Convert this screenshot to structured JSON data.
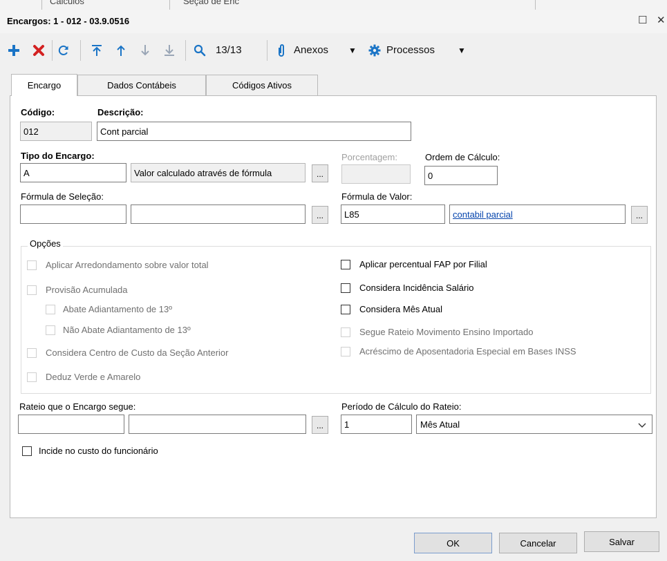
{
  "background_window": {
    "items": [
      "Calculos",
      "Seção de Enc"
    ]
  },
  "dialog": {
    "title": "Encargos: 1 - 012 - 03.9.0516",
    "maximize_glyph": "☐",
    "close_glyph": "✕"
  },
  "toolbar": {
    "add_icon": "plus-icon",
    "delete_icon": "x-icon",
    "refresh_icon": "refresh-icon",
    "record_counter": "13/13",
    "attachments_label": "Anexos",
    "processes_label": "Processos",
    "colors": {
      "add": "#1a74c6",
      "delete": "#d32121",
      "nav": "#1a74c6"
    }
  },
  "tabs": [
    {
      "label": "Encargo",
      "active": true
    },
    {
      "label": "Dados Contábeis",
      "active": false
    },
    {
      "label": "Códigos Ativos",
      "active": false
    }
  ],
  "form": {
    "codigo": {
      "label": "Código:",
      "value": "012"
    },
    "descricao": {
      "label": "Descrição:",
      "value": "Cont parcial"
    },
    "tipo_encargo": {
      "label": "Tipo do Encargo:",
      "code": "A",
      "description": "Valor calculado através de fórmula"
    },
    "porcentagem": {
      "label": "Porcentagem:",
      "value": ""
    },
    "ordem_calculo": {
      "label": "Ordem de Cálculo:",
      "value": "0"
    },
    "formula_selecao": {
      "label": "Fórmula de Seleção:",
      "code": "",
      "description": ""
    },
    "formula_valor": {
      "label": "Fórmula de Valor:",
      "code": "L85",
      "description": "contabil parcial"
    },
    "browse_label": "..."
  },
  "options": {
    "label": "Opções",
    "left": [
      {
        "label": "Aplicar Arredondamento sobre valor total",
        "checked": false,
        "enabled": false
      },
      {
        "label": "Provisão Acumulada",
        "checked": false,
        "enabled": false
      },
      {
        "label": "Abate Adiantamento de 13º",
        "checked": false,
        "enabled": false
      },
      {
        "label": "Não Abate Adiantamento de 13º",
        "checked": false,
        "enabled": false
      },
      {
        "label": "Considera Centro de Custo da Seção Anterior",
        "checked": false,
        "enabled": false
      },
      {
        "label": "Deduz Verde e Amarelo",
        "checked": false,
        "enabled": false
      }
    ],
    "right": [
      {
        "label": "Aplicar percentual FAP por Filial",
        "checked": false,
        "enabled": true
      },
      {
        "label": "Considera Incidência Salário",
        "checked": false,
        "enabled": true
      },
      {
        "label": "Considera Mês Atual",
        "checked": false,
        "enabled": true
      },
      {
        "label": "Segue Rateio Movimento Ensino Importado",
        "checked": false,
        "enabled": false
      },
      {
        "label": "Acréscimo de Aposentadoria Especial em Bases INSS",
        "checked": false,
        "enabled": false
      }
    ]
  },
  "rateio": {
    "label": "Rateio que o Encargo segue:",
    "code": "",
    "description": "",
    "periodo_label": "Período de Cálculo do Rateio:",
    "periodo_value": "1",
    "periodo_select": "Mês Atual"
  },
  "incide_custo": {
    "label": "Incide no custo do funcionário",
    "checked": false
  },
  "buttons": {
    "ok": "OK",
    "cancel": "Cancelar",
    "save": "Salvar"
  }
}
